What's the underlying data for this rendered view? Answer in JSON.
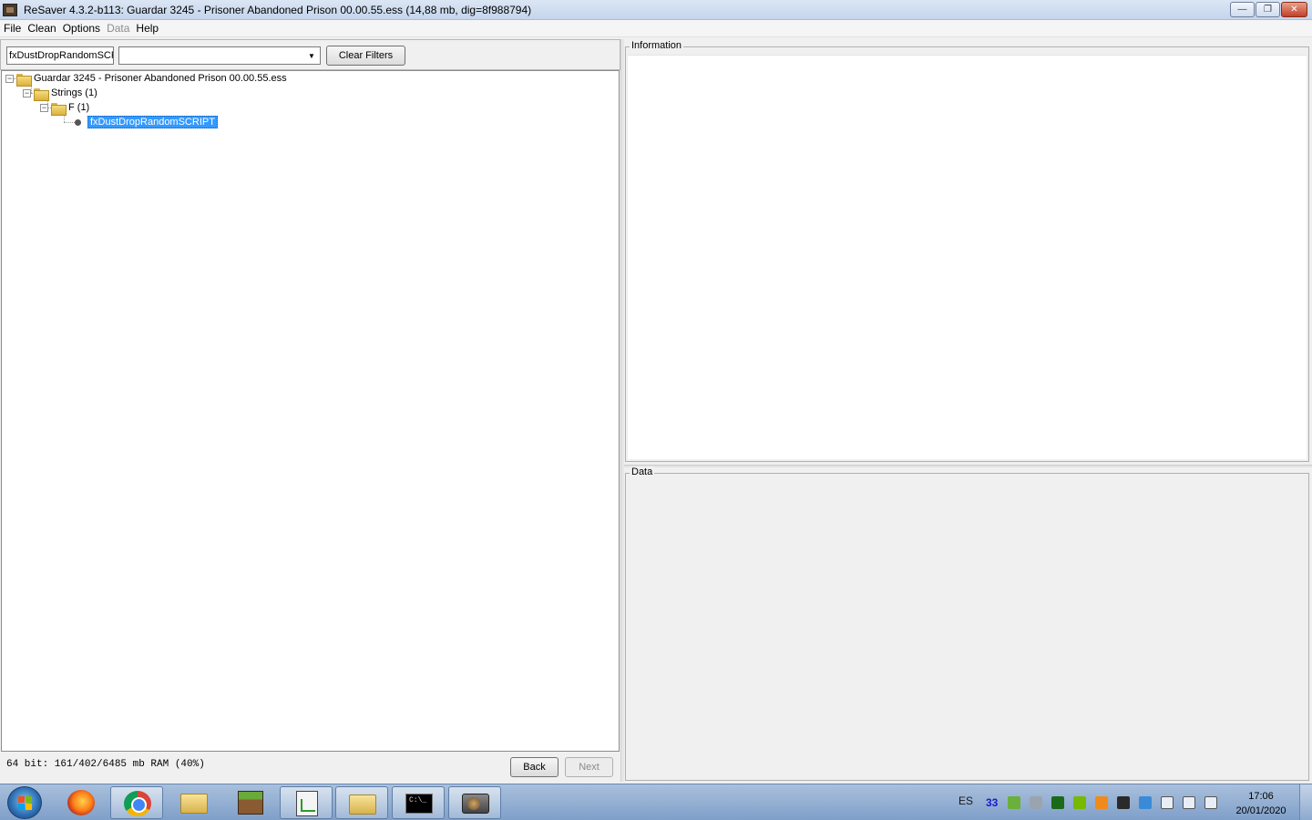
{
  "window": {
    "title": "ReSaver 4.3.2-b113: Guardar 3245 - Prisoner  Abandoned Prison  00.00.55.ess (14,88 mb, dig=8f988794)",
    "minimize": "—",
    "restore": "❐",
    "close": "✕"
  },
  "menu": {
    "file": "File",
    "clean": "Clean",
    "options": "Options",
    "data": "Data",
    "help": "Help"
  },
  "filter": {
    "text_value": "fxDustDropRandomSCR",
    "combo_value": "",
    "clear_label": "Clear Filters"
  },
  "tree": {
    "root": "Guardar 3245 - Prisoner  Abandoned Prison  00.00.55.ess",
    "strings": "Strings (1)",
    "f_group": "F (1)",
    "leaf": "fxDustDropRandomSCRIPT"
  },
  "status": {
    "memory": "64 bit: 161/402/6485 mb RAM (40%)",
    "back_label": "Back",
    "next_label": "Next"
  },
  "panels": {
    "information": "Information",
    "data": "Data"
  },
  "taskbar": {
    "lang": "ES",
    "tray_num": "33",
    "time": "17:06",
    "date": "20/01/2020"
  },
  "colors": {
    "selection": "#3399ff",
    "taskbar": "#8fb0d6"
  }
}
